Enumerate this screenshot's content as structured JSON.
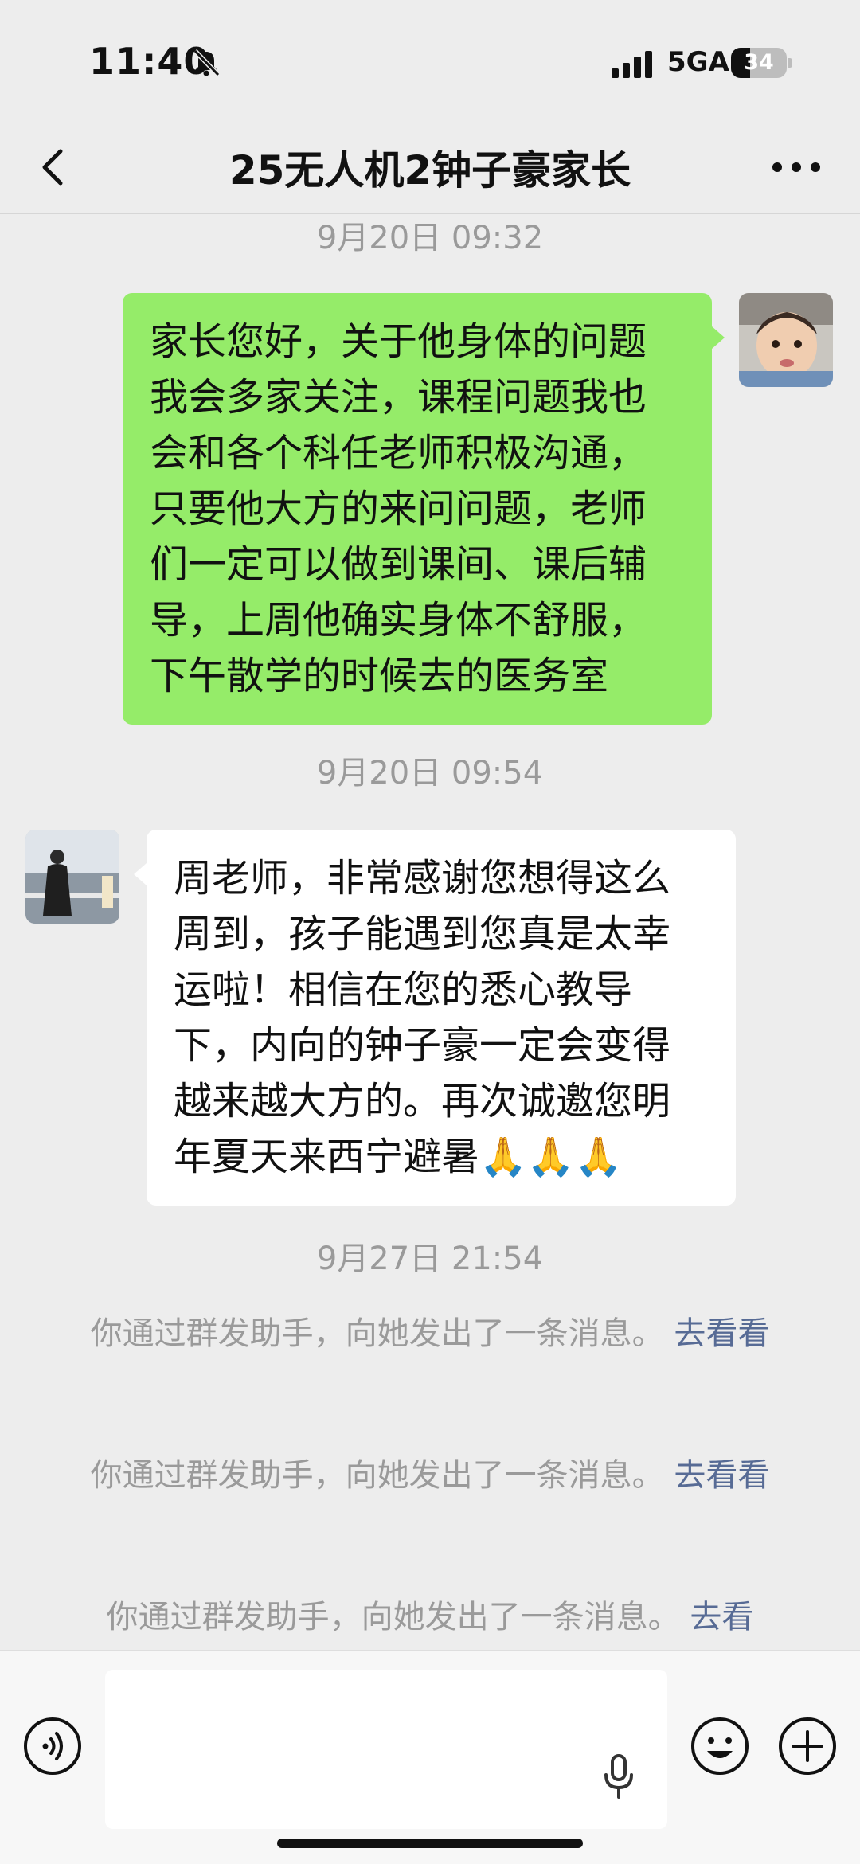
{
  "status_bar": {
    "time": "11:40",
    "network": "5GA",
    "battery_level": "34",
    "battery_fraction": 0.34
  },
  "header": {
    "title": "25无人机2钟子豪家长"
  },
  "messages": [
    {
      "timestamp": "9月20日 09:32",
      "direction": "outgoing",
      "lines": [
        "家长您好，关于他身体的问题",
        "我会多家关注，课程问题我也",
        "会和各个科任老师积极沟通，",
        "只要他大方的来问问题，老师",
        "们一定可以做到课间、课后辅",
        "导，上周他确实身体不舒服，",
        "下午散学的时候去的医务室"
      ]
    },
    {
      "timestamp": "9月20日 09:54",
      "direction": "incoming",
      "lines": [
        "周老师，非常感谢您想得这么",
        "周到，孩子能遇到您真是太幸",
        "运啦！相信在您的悉心教导",
        "下，内向的钟子豪一定会变得",
        "越来越大方的。再次诚邀您明",
        "年夏天来西宁避暑"
      ],
      "emoji": "🙏🙏🙏"
    }
  ],
  "system": {
    "timestamp": "9月27日 21:54",
    "notes": [
      {
        "text": "你通过群发助手，向她发出了一条消息。",
        "link": "去看看"
      },
      {
        "text": "你通过群发助手，向她发出了一条消息。",
        "link": "去看看"
      },
      {
        "text": "你通过群发助手，向她发出了一条消息。",
        "link": "去看"
      }
    ]
  },
  "icons": {
    "back": "chevron-left-icon",
    "more": "more-dots-icon",
    "voice": "voice-icon",
    "mic": "mic-icon",
    "emoji": "emoji-icon",
    "plus": "plus-icon"
  },
  "colors": {
    "outgoing_bubble": "#95ec69",
    "incoming_bubble": "#ffffff",
    "background": "#ededed",
    "link": "#576b95"
  }
}
